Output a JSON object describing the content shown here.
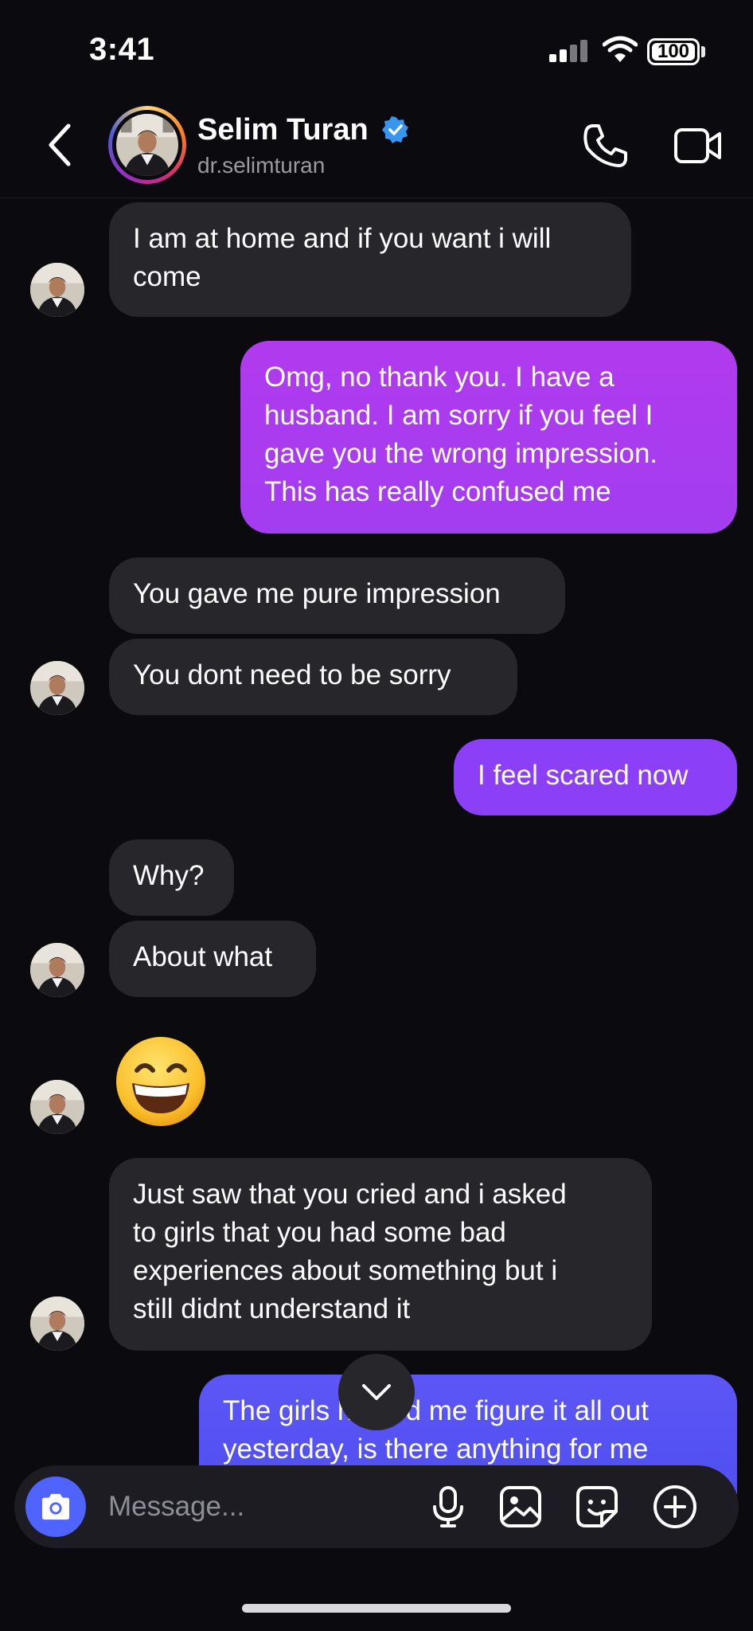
{
  "status_bar": {
    "time": "3:41",
    "battery": "100"
  },
  "header": {
    "name": "Selim Turan",
    "handle": "dr.selimturan",
    "back_icon": "chevron-left-icon",
    "call_icon": "phone-icon",
    "video_icon": "video-camera-icon",
    "verified_icon": "verified-badge-icon"
  },
  "messages": [
    {
      "from": "them",
      "text_lines": [
        "I am at home and if you want i will",
        "come"
      ]
    },
    {
      "from": "me",
      "text_lines": [
        "Omg, no thank you. I have a",
        "husband. I am sorry if you feel I",
        "gave you the wrong impression.",
        "This has really confused me"
      ]
    },
    {
      "from": "them",
      "text": "You gave me pure impression"
    },
    {
      "from": "them",
      "text": "You dont need to be sorry"
    },
    {
      "from": "me",
      "text": "I feel scared now"
    },
    {
      "from": "them",
      "text": "Why?"
    },
    {
      "from": "them",
      "text": "About what"
    },
    {
      "from": "them",
      "emoji": "grinning-face-with-smiling-eyes"
    },
    {
      "from": "them",
      "text_lines": [
        "Just saw that you cried and i asked",
        "to girls that you had some bad",
        "experiences about something but i",
        "still didnt understand it"
      ]
    },
    {
      "from": "me",
      "text_lines": [
        "The girls helped me figure it all out",
        "yesterday, is there anything for me"
      ]
    }
  ],
  "composer": {
    "placeholder": "Message...",
    "camera_icon": "camera-icon",
    "mic_icon": "microphone-icon",
    "gallery_icon": "image-icon",
    "sticker_icon": "sticker-icon",
    "add_icon": "plus-circle-icon"
  },
  "colors": {
    "background": "#0b0b0f",
    "incoming_bubble": "#26262b",
    "outgoing_purple": "#a53cf0",
    "outgoing_violet": "#8b3ff7",
    "outgoing_blue": "#5b54f5",
    "camera_button": "#4f63ff",
    "verified_blue": "#3797f0"
  }
}
